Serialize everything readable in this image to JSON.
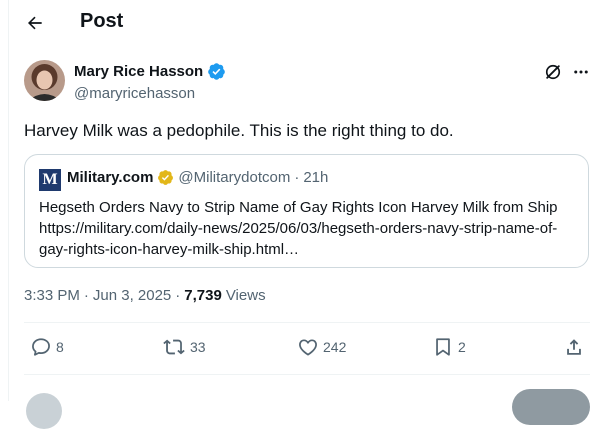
{
  "header": {
    "title": "Post"
  },
  "author": {
    "name": "Mary Rice Hasson",
    "handle": "@maryricehasson"
  },
  "post": {
    "text": "Harvey Milk was a pedophile.  This is the right thing to do."
  },
  "quote": {
    "logo_letter": "M",
    "name": "Military.com",
    "handle": "@Militarydotcom",
    "separator": "·",
    "time": "21h",
    "text": "Hegseth Orders Navy to Strip Name of Gay Rights Icon Harvey Milk from Ship https://military.com/daily-news/2025/06/03/hegseth-orders-navy-strip-name-of-gay-rights-icon-harvey-milk-ship.html…"
  },
  "meta": {
    "time": "3:33 PM",
    "separator": "·",
    "date": "Jun 3, 2025",
    "views_count": "7,739",
    "views_label": "Views"
  },
  "actions": {
    "replies": "8",
    "reposts": "33",
    "likes": "242",
    "bookmarks": "2"
  },
  "colors": {
    "verified_blue": "#1d9bf0",
    "verified_gold": "#e2b719",
    "secondary_text": "#536471"
  },
  "icons": [
    "back-arrow-icon",
    "verified-badge-icon",
    "grok-icon",
    "more-icon",
    "gold-check-icon",
    "reply-icon",
    "repost-icon",
    "like-icon",
    "bookmark-icon",
    "share-icon"
  ]
}
